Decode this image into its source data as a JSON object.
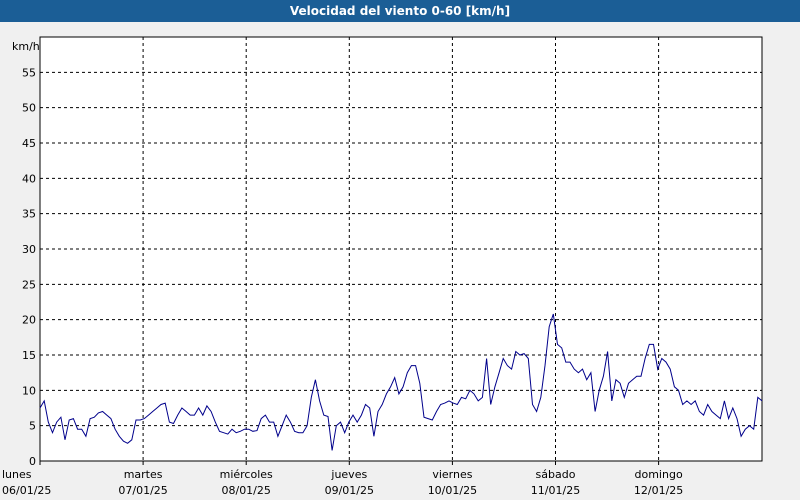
{
  "window": {
    "title": "Velocidad del viento 0-60 [km/h]"
  },
  "chart_data": {
    "type": "line",
    "title": "Velocidad del viento 0-60 [km/h]",
    "ylabel": "km/h",
    "ylim": [
      0,
      60
    ],
    "yticks": [
      0,
      5,
      10,
      15,
      20,
      25,
      30,
      35,
      40,
      45,
      50,
      55
    ],
    "grid": true,
    "line_color": "#00008b",
    "day_labels": [
      {
        "day": "lunes",
        "date": "06/01/25"
      },
      {
        "day": "martes",
        "date": "07/01/25"
      },
      {
        "day": "miércoles",
        "date": "08/01/25"
      },
      {
        "day": "jueves",
        "date": "09/01/25"
      },
      {
        "day": "viernes",
        "date": "10/01/25"
      },
      {
        "day": "sábado",
        "date": "11/01/25"
      },
      {
        "day": "domingo",
        "date": "12/01/25"
      }
    ],
    "series": [
      {
        "values": [
          7.5,
          8.5,
          5.5,
          4.0,
          5.5,
          6.2,
          3.0,
          5.8,
          6.0,
          4.5,
          4.5,
          3.5,
          6.0,
          6.2,
          6.8,
          7.0,
          6.5,
          6.0,
          4.5,
          3.5,
          2.8,
          2.5,
          3.0,
          5.8,
          5.8,
          6.0,
          6.5,
          7.0,
          7.5,
          8.0,
          8.2,
          5.5,
          5.3,
          6.5,
          7.5,
          7.0,
          6.5,
          6.5,
          7.5,
          6.5,
          7.8,
          7.0,
          5.5,
          4.2,
          4.0,
          3.8,
          4.5,
          4.0,
          4.2,
          4.5,
          4.5,
          4.2,
          4.3,
          6.0,
          6.5,
          5.5,
          5.5,
          3.5,
          5.0,
          6.5,
          5.5,
          4.2,
          4.0,
          4.0,
          5.0,
          9.0,
          11.5,
          8.5,
          6.5,
          6.3,
          1.5,
          5.0,
          5.5,
          4.0,
          5.5,
          6.5,
          5.5,
          6.5,
          8.0,
          7.5,
          3.5,
          7.0,
          8.0,
          9.5,
          10.5,
          11.8,
          9.5,
          10.5,
          12.5,
          13.5,
          13.5,
          11.0,
          6.2,
          6.0,
          5.8,
          7.0,
          8.0,
          8.2,
          8.5,
          8.2,
          8.0,
          9.0,
          8.8,
          10.0,
          9.5,
          8.5,
          9.0,
          14.5,
          8.0,
          10.5,
          12.5,
          14.5,
          13.5,
          13.0,
          15.5,
          15.0,
          15.2,
          14.5,
          8.0,
          7.0,
          9.0,
          13.5,
          19.0,
          20.8,
          16.5,
          16.0,
          14.0,
          14.0,
          13.0,
          12.5,
          13.0,
          11.5,
          12.5,
          7.0,
          10.0,
          12.0,
          15.5,
          8.5,
          11.5,
          11.0,
          9.0,
          11.0,
          11.5,
          12.0,
          12.0,
          14.5,
          16.5,
          16.5,
          13.0,
          14.5,
          14.0,
          13.0,
          10.5,
          10.0,
          8.0,
          8.5,
          8.0,
          8.5,
          7.0,
          6.5,
          8.0,
          7.0,
          6.5,
          6.0,
          8.5,
          6.0,
          7.5,
          6.0,
          3.5,
          4.5,
          5.0,
          4.5,
          9.0,
          8.5
        ]
      }
    ]
  }
}
